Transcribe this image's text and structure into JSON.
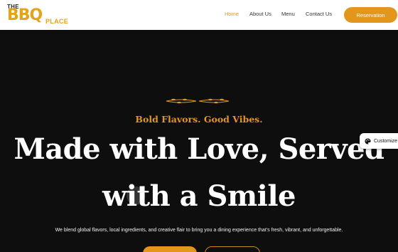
{
  "header": {
    "logo": {
      "the": "THE",
      "bbq": "BBQ",
      "place": "PLACE"
    },
    "nav": [
      {
        "label": "Home",
        "active": true
      },
      {
        "label": "About Us"
      },
      {
        "label": "Menu"
      },
      {
        "label": "Contact Us"
      }
    ],
    "reservation_label": "Reservation"
  },
  "hero": {
    "tagline": "Bold Flavors. Good Vibes.",
    "headline_line1": "Made with Love, Served",
    "headline_line2": "with a Smile",
    "paragraph": "We blend global flavors, local ingredients, and creative flair to bring you a dining experience that’s fresh, vibrant, and unforgettable."
  },
  "widget": {
    "customize_label": "Customize",
    "icon": "palette-icon"
  },
  "colors": {
    "accent": "#e3961c",
    "logo": "#e3a31c",
    "background": "#0e0e0e",
    "header_bg": "#ffffff",
    "nav_active": "#d99a27"
  }
}
